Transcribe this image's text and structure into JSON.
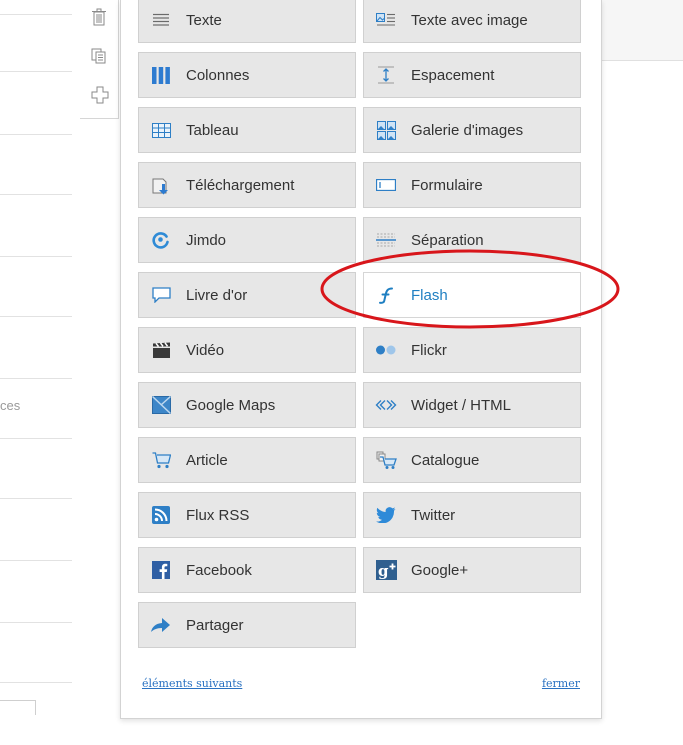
{
  "page": {
    "partial_text": "ces"
  },
  "toolbar": {
    "tools": [
      {
        "name": "trash-icon"
      },
      {
        "name": "copy-icon"
      },
      {
        "name": "move-icon"
      }
    ]
  },
  "panel": {
    "left_column": [
      {
        "label": "Texte",
        "icon": "text-lines-icon"
      },
      {
        "label": "Colonnes",
        "icon": "columns-icon"
      },
      {
        "label": "Tableau",
        "icon": "table-icon"
      },
      {
        "label": "Téléchargement",
        "icon": "download-icon"
      },
      {
        "label": "Jimdo",
        "icon": "jimdo-icon"
      },
      {
        "label": "Livre d'or",
        "icon": "speech-bubble-icon"
      },
      {
        "label": "Vidéo",
        "icon": "clapperboard-icon"
      },
      {
        "label": "Google Maps",
        "icon": "map-icon"
      },
      {
        "label": "Article",
        "icon": "shopping-cart-icon"
      },
      {
        "label": "Flux RSS",
        "icon": "rss-icon"
      },
      {
        "label": "Facebook",
        "icon": "facebook-icon"
      },
      {
        "label": "Partager",
        "icon": "share-arrow-icon"
      }
    ],
    "right_column": [
      {
        "label": "Texte avec image",
        "icon": "text-image-icon"
      },
      {
        "label": "Espacement",
        "icon": "spacing-icon"
      },
      {
        "label": "Galerie d'images",
        "icon": "gallery-icon"
      },
      {
        "label": "Formulaire",
        "icon": "form-icon"
      },
      {
        "label": "Séparation",
        "icon": "separator-icon"
      },
      {
        "label": "Flash",
        "icon": "flash-icon",
        "active": true
      },
      {
        "label": "Flickr",
        "icon": "flickr-icon"
      },
      {
        "label": "Widget / HTML",
        "icon": "code-icon"
      },
      {
        "label": "Catalogue",
        "icon": "catalogue-icon"
      },
      {
        "label": "Twitter",
        "icon": "twitter-icon"
      },
      {
        "label": "Google+",
        "icon": "google-plus-icon"
      }
    ],
    "footer": {
      "next_label": "éléments suivants",
      "close_label": "fermer"
    }
  },
  "colors": {
    "accent": "#1f7fc2",
    "highlight": "#d8161b"
  }
}
